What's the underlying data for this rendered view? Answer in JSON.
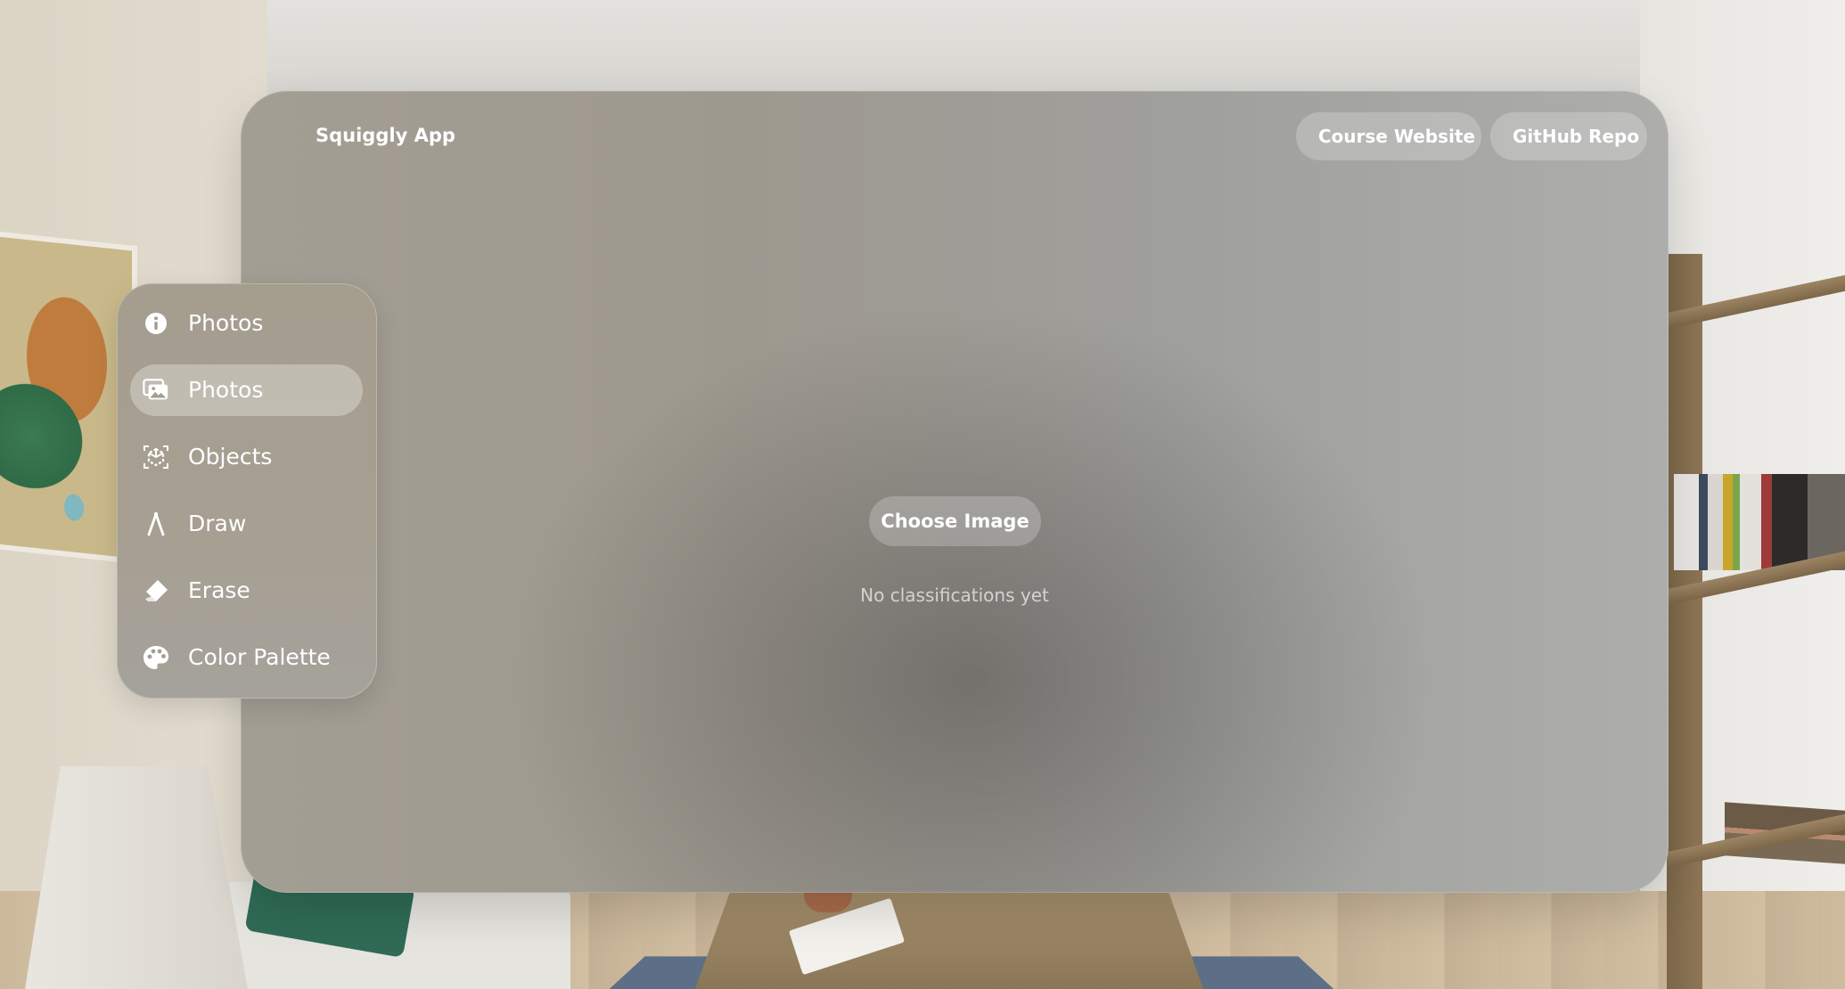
{
  "app": {
    "title": "Squiggly App"
  },
  "header": {
    "buttons": [
      {
        "label": "Course Website"
      },
      {
        "label": "GitHub Repo"
      }
    ]
  },
  "sidebar": {
    "items": [
      {
        "label": "Photos",
        "icon": "info-icon",
        "selected": false
      },
      {
        "label": "Photos",
        "icon": "photo-icon",
        "selected": true
      },
      {
        "label": "Objects",
        "icon": "objects-icon",
        "selected": false
      },
      {
        "label": "Draw",
        "icon": "pen-nib-icon",
        "selected": false
      },
      {
        "label": "Erase",
        "icon": "eraser-icon",
        "selected": false
      },
      {
        "label": "Color Palette",
        "icon": "palette-icon",
        "selected": false
      }
    ]
  },
  "main": {
    "choose_image_label": "Choose Image",
    "status_text": "No classifications yet"
  },
  "colors": {
    "text": "#ffffff",
    "selected_bg": "rgba(255,255,255,0.30)"
  }
}
